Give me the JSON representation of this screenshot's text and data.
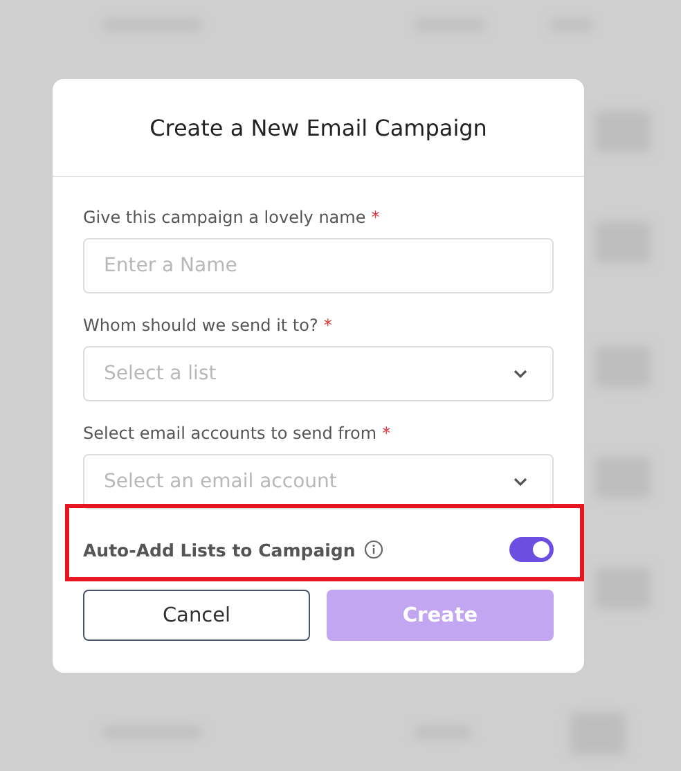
{
  "dialog": {
    "title": "Create a New Email Campaign",
    "fields": [
      {
        "kind": "text",
        "label": "Give this campaign a lovely name",
        "required_mark": "*",
        "placeholder": "Enter a Name"
      },
      {
        "kind": "select",
        "label": "Whom should we send it to?",
        "required_mark": "*",
        "placeholder": "Select a list"
      },
      {
        "kind": "select",
        "label": "Select email accounts to send from",
        "required_mark": "*",
        "placeholder": "Select an email account"
      }
    ],
    "toggle": {
      "label": "Auto-Add Lists to Campaign",
      "on": true
    },
    "buttons": [
      {
        "label": "Cancel",
        "kind": "secondary",
        "disabled": false
      },
      {
        "label": "Create",
        "kind": "primary",
        "disabled": true
      }
    ]
  },
  "highlight": {
    "shown": true
  }
}
